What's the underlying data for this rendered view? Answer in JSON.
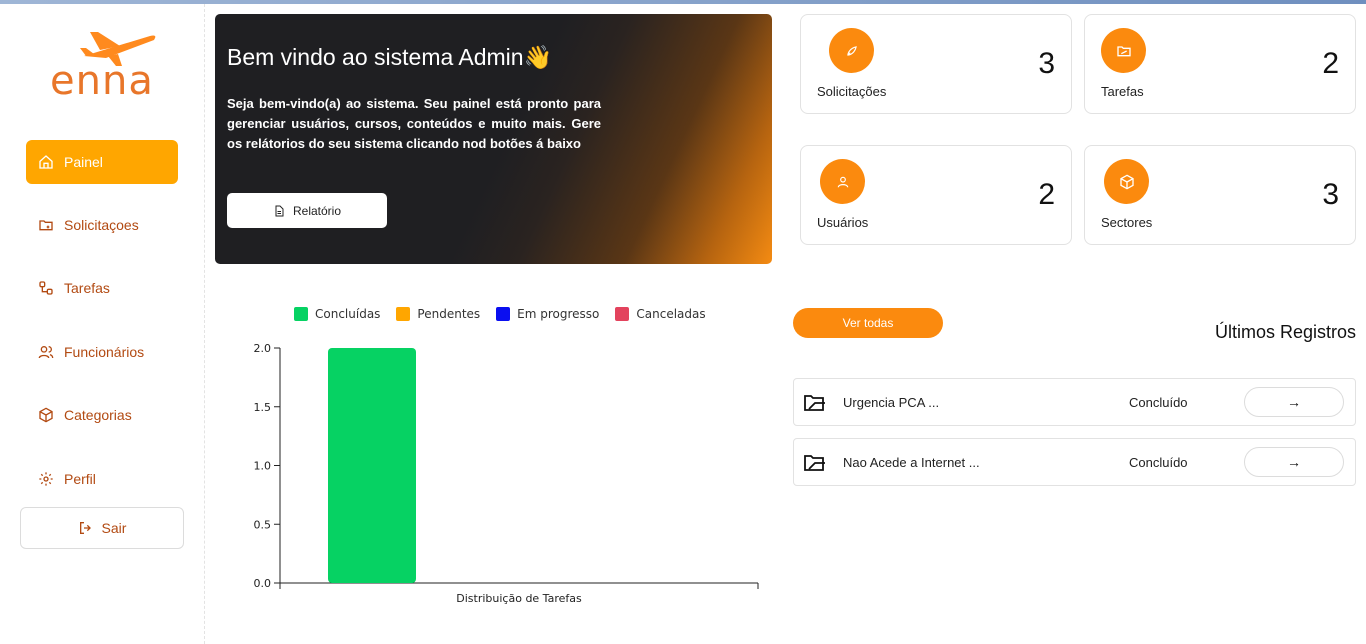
{
  "brand": {
    "name": "enna",
    "color": "#e8762a"
  },
  "sidebar": {
    "items": [
      {
        "label": "Painel",
        "icon": "home-icon",
        "active": true
      },
      {
        "label": "Solicitaçoes",
        "icon": "folder-icon"
      },
      {
        "label": "Tarefas",
        "icon": "workflow-icon"
      },
      {
        "label": "Funcionários",
        "icon": "users-icon"
      },
      {
        "label": "Categorias",
        "icon": "box-icon"
      },
      {
        "label": "Perfil",
        "icon": "gear-icon"
      }
    ],
    "logout_label": "Sair"
  },
  "hero": {
    "title": "Bem vindo ao sistema Admin👋",
    "description": "Seja bem-vindo(a) ao sistema. Seu painel está pronto para gerenciar usuários, cursos, conteúdos e muito mais. Gere os relátorios do seu sistema clicando nod botões á baixo",
    "button_label": "Relatório"
  },
  "stats": [
    {
      "label": "Solicitações",
      "value": "3",
      "icon": "rocket-icon"
    },
    {
      "label": "Tarefas",
      "value": "2",
      "icon": "folder-icon"
    },
    {
      "label": "Usuários",
      "value": "2",
      "icon": "user-icon"
    },
    {
      "label": "Sectores",
      "value": "3",
      "icon": "box-icon"
    }
  ],
  "chart_data": {
    "type": "bar",
    "categories": [
      "Distribuição de Tarefas"
    ],
    "series": [
      {
        "name": "Concluídas",
        "color": "#06d263",
        "values": [
          2
        ]
      },
      {
        "name": "Pendentes",
        "color": "#ffa600",
        "values": [
          0
        ]
      },
      {
        "name": "Em progresso",
        "color": "#0a0ff0",
        "values": [
          0
        ]
      },
      {
        "name": "Canceladas",
        "color": "#e3435d",
        "values": [
          0
        ]
      }
    ],
    "yticks": [
      "0.0",
      "0.5",
      "1.0",
      "1.5",
      "2.0"
    ],
    "ylim": [
      0,
      2
    ],
    "legend": "top"
  },
  "records": {
    "title": "Últimos Registros",
    "view_all_label": "Ver todas",
    "items": [
      {
        "name": "Urgencia PCA ...",
        "status": "Concluído",
        "action": "→"
      },
      {
        "name": "Nao Acede a Internet ...",
        "status": "Concluído",
        "action": "→"
      }
    ]
  }
}
